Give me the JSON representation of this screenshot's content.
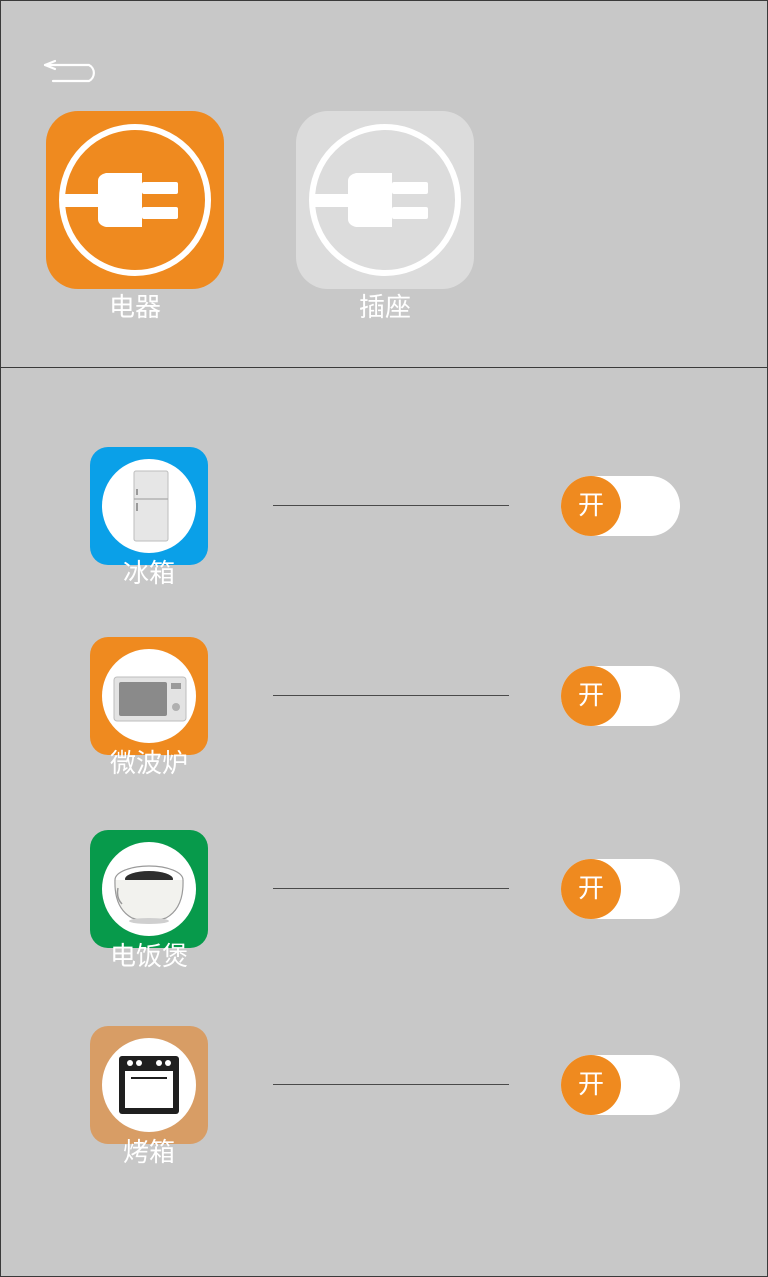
{
  "header": {
    "back_icon": "back-arrow-icon"
  },
  "categories": [
    {
      "label": "电器",
      "icon": "plug-icon",
      "color": "#ef8a1f",
      "selected": true
    },
    {
      "label": "插座",
      "icon": "plug-icon",
      "color": "#dcdcdc",
      "selected": false
    }
  ],
  "devices": [
    {
      "label": "冰箱",
      "icon": "fridge-icon",
      "color": "#0aa0e8",
      "toggle_label": "开",
      "on": true
    },
    {
      "label": "微波炉",
      "icon": "microwave-icon",
      "color": "#ef8a1f",
      "toggle_label": "开",
      "on": true
    },
    {
      "label": "电饭煲",
      "icon": "rice-cooker-icon",
      "color": "#079a4b",
      "toggle_label": "开",
      "on": true
    },
    {
      "label": "烤箱",
      "icon": "oven-icon",
      "color": "#d89d65",
      "toggle_label": "开",
      "on": true
    }
  ],
  "colors": {
    "background": "#c8c8c8",
    "accent": "#ef8a1f",
    "divider": "#3a3a3a"
  }
}
